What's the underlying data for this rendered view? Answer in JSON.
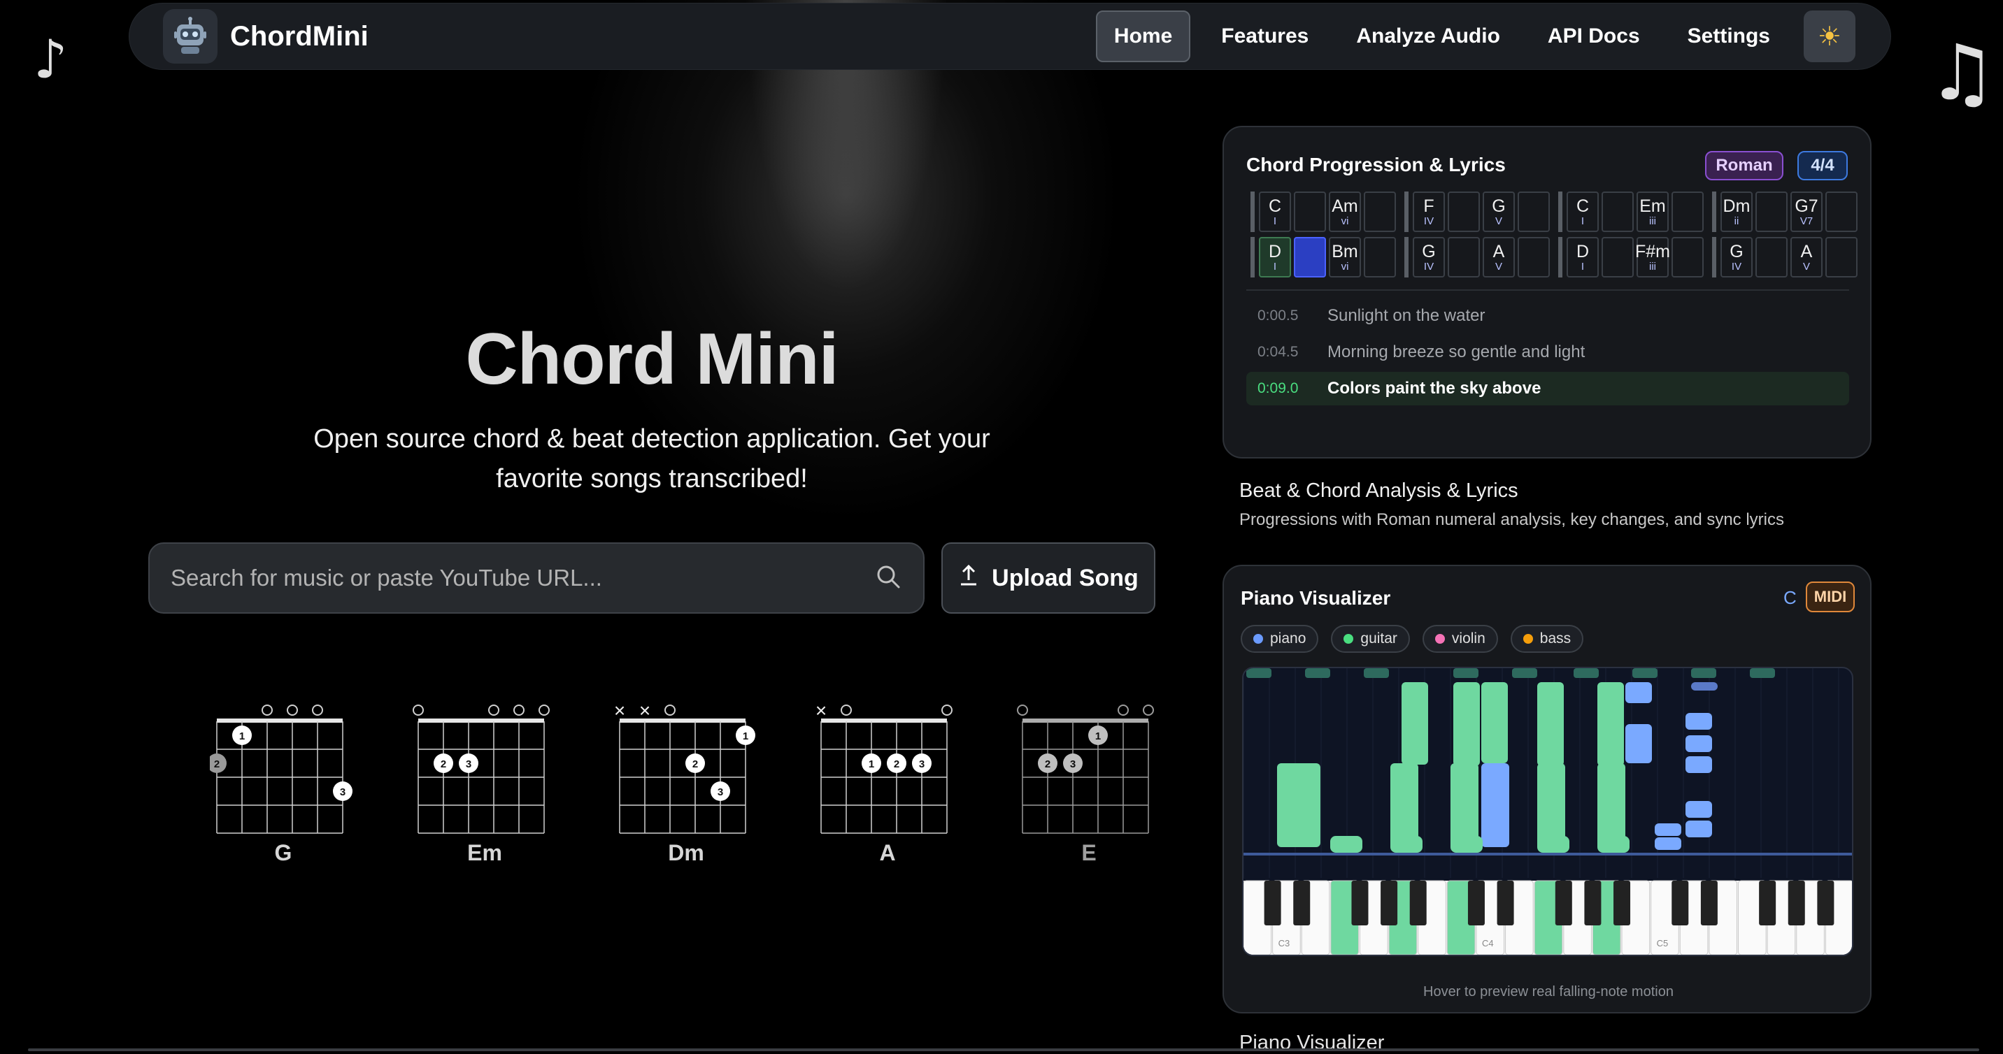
{
  "nav": {
    "brand": "ChordMini",
    "items": [
      {
        "label": "Home",
        "active": true
      },
      {
        "label": "Features"
      },
      {
        "label": "Analyze Audio"
      },
      {
        "label": "API Docs"
      },
      {
        "label": "Settings"
      }
    ],
    "theme_icon": "sun-icon"
  },
  "hero": {
    "title": "Chord Mini",
    "subtitle_line1": "Open source chord & beat detection application. Get your",
    "subtitle_line2": "favorite songs transcribed!",
    "search_placeholder": "Search for music or paste YouTube URL...",
    "upload_label": "Upload Song"
  },
  "chords": [
    {
      "name": "G"
    },
    {
      "name": "Em"
    },
    {
      "name": "Dm"
    },
    {
      "name": "A"
    },
    {
      "name": "E"
    }
  ],
  "progression_card": {
    "title": "Chord Progression & Lyrics",
    "badge_roman": "Roman",
    "badge_time": "4/4",
    "row1": [
      [
        {
          "c": "C",
          "r": "I"
        },
        {
          "c": "",
          "r": ""
        },
        {
          "c": "Am",
          "r": "vi"
        },
        {
          "c": "",
          "r": ""
        }
      ],
      [
        {
          "c": "F",
          "r": "IV"
        },
        {
          "c": "",
          "r": ""
        },
        {
          "c": "G",
          "r": "V"
        },
        {
          "c": "",
          "r": ""
        }
      ],
      [
        {
          "c": "C",
          "r": "I"
        },
        {
          "c": "",
          "r": ""
        },
        {
          "c": "Em",
          "r": "iii"
        },
        {
          "c": "",
          "r": ""
        }
      ],
      [
        {
          "c": "Dm",
          "r": "ii"
        },
        {
          "c": "",
          "r": ""
        },
        {
          "c": "G7",
          "r": "V7"
        },
        {
          "c": "",
          "r": ""
        }
      ]
    ],
    "row2": [
      [
        {
          "c": "D",
          "r": "I",
          "hl": true
        },
        {
          "c": "",
          "r": "",
          "cur": true
        },
        {
          "c": "Bm",
          "r": "vi"
        },
        {
          "c": "",
          "r": ""
        }
      ],
      [
        {
          "c": "G",
          "r": "IV"
        },
        {
          "c": "",
          "r": ""
        },
        {
          "c": "A",
          "r": "V"
        },
        {
          "c": "",
          "r": ""
        }
      ],
      [
        {
          "c": "D",
          "r": "I"
        },
        {
          "c": "",
          "r": ""
        },
        {
          "c": "F#m",
          "r": "iii"
        },
        {
          "c": "",
          "r": ""
        }
      ],
      [
        {
          "c": "G",
          "r": "IV"
        },
        {
          "c": "",
          "r": ""
        },
        {
          "c": "A",
          "r": "V"
        },
        {
          "c": "",
          "r": ""
        }
      ]
    ],
    "lyrics": [
      {
        "time": "0:00.5",
        "text": "Sunlight on the water"
      },
      {
        "time": "0:04.5",
        "text": "Morning breeze so gentle and light"
      },
      {
        "time": "0:09.0",
        "text": "Colors paint the sky above",
        "active": true
      }
    ]
  },
  "feature1": {
    "title": "Beat & Chord Analysis & Lyrics",
    "desc": "Progressions with Roman numeral analysis, key changes, and sync lyrics"
  },
  "piano_card": {
    "title": "Piano Visualizer",
    "key": "C",
    "badge": "MIDI",
    "instruments": [
      {
        "label": "piano",
        "color": "#6b9bff"
      },
      {
        "label": "guitar",
        "color": "#4ade80"
      },
      {
        "label": "violin",
        "color": "#f472b6"
      },
      {
        "label": "bass",
        "color": "#f59e0b"
      }
    ],
    "key_labels": [
      "C3",
      "C4",
      "C5"
    ],
    "hint": "Hover to preview real falling-note motion"
  },
  "bottom_label": "Piano Visualizer",
  "colors": {
    "accent_green": "#4ade80",
    "accent_blue": "#6b9bff",
    "roman_purple": "#8a4fd1"
  }
}
